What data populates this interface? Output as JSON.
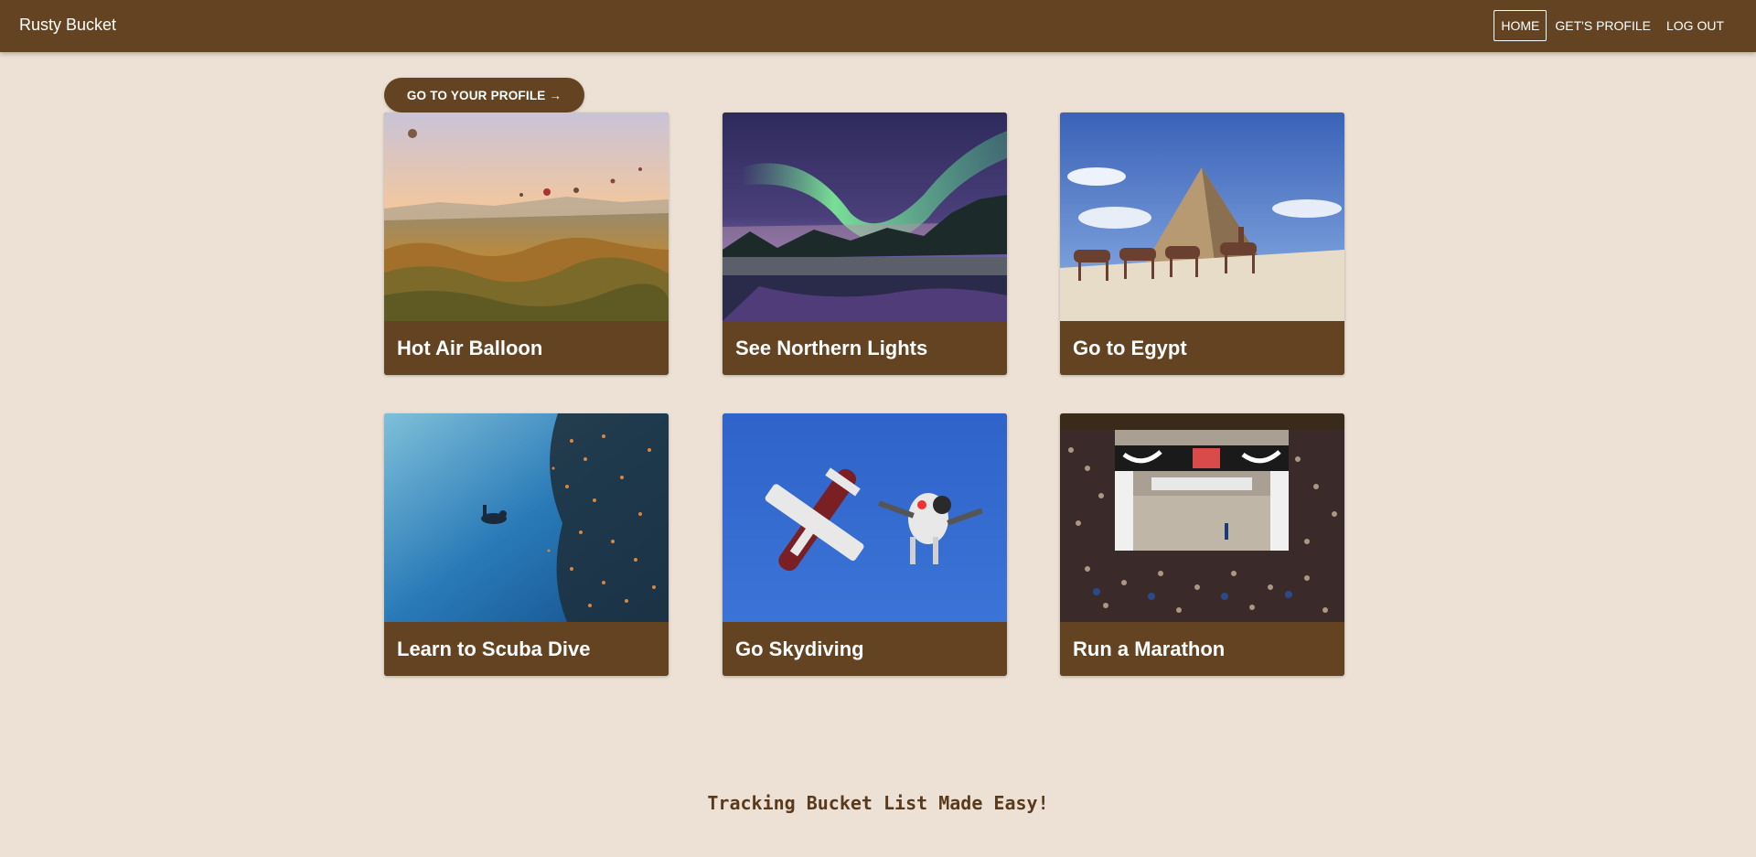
{
  "header": {
    "brand": "Rusty Bucket",
    "nav": [
      {
        "label": "HOME",
        "active": true
      },
      {
        "label": "GET'S PROFILE",
        "active": false
      },
      {
        "label": "LOG OUT",
        "active": false
      }
    ]
  },
  "main": {
    "profile_button": "GO TO YOUR PROFILE →",
    "cards": [
      {
        "title": "Hot Air Balloon",
        "image": "hot-air-balloons-landscape"
      },
      {
        "title": "See Northern Lights",
        "image": "aurora-over-lake"
      },
      {
        "title": "Go to Egypt",
        "image": "pyramid-with-camels"
      },
      {
        "title": "Learn to Scuba Dive",
        "image": "diver-with-fish-school"
      },
      {
        "title": "Go Skydiving",
        "image": "skydiver-and-plane"
      },
      {
        "title": "Run a Marathon",
        "image": "marathon-finish-line"
      }
    ]
  },
  "footer": {
    "tagline": "Tracking Bucket List Made Easy!"
  },
  "colors": {
    "background": "#ede1d5",
    "accent": "#634322",
    "text_on_accent": "#ffffff"
  }
}
